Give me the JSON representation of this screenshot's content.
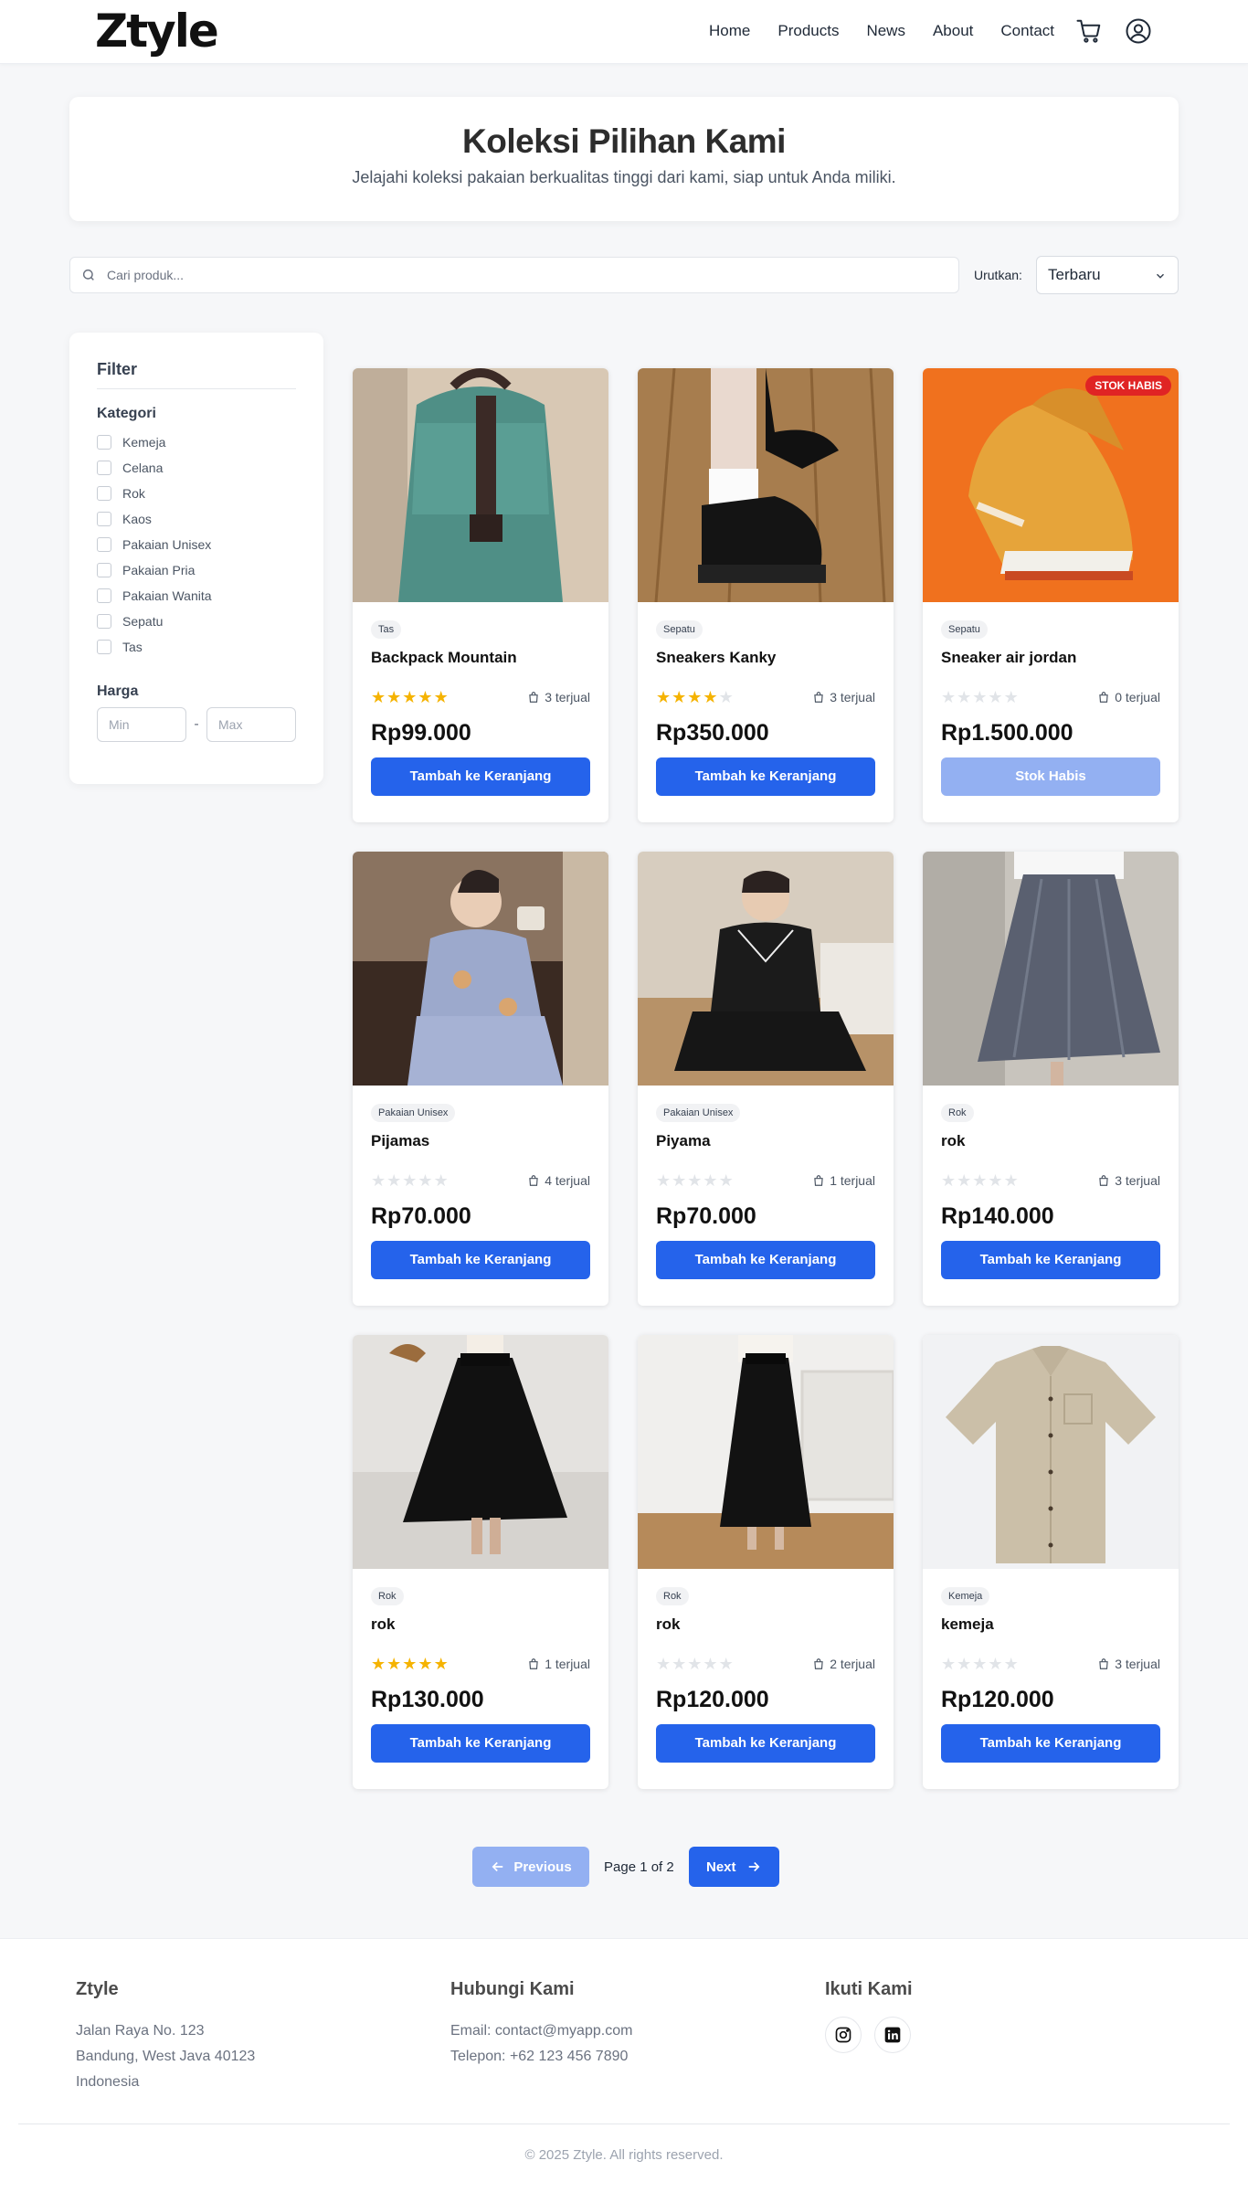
{
  "brand": {
    "logo": "Ztyle"
  },
  "nav": {
    "items": [
      "Home",
      "Products",
      "News",
      "About",
      "Contact"
    ],
    "cart_icon": "cart-icon",
    "user_icon": "user-icon"
  },
  "hero": {
    "title": "Koleksi Pilihan Kami",
    "subtitle": "Jelajahi koleksi pakaian berkualitas tinggi dari kami, siap untuk Anda miliki."
  },
  "search": {
    "placeholder": "Cari produk..."
  },
  "sort": {
    "label": "Urutkan:",
    "selected": "Terbaru"
  },
  "filter": {
    "title": "Filter",
    "category_title": "Kategori",
    "categories": [
      "Kemeja",
      "Celana",
      "Rok",
      "Kaos",
      "Pakaian Unisex",
      "Pakaian Pria",
      "Pakaian Wanita",
      "Sepatu",
      "Tas"
    ],
    "price_title": "Harga",
    "min_placeholder": "Min",
    "max_placeholder": "Max",
    "separator": "-"
  },
  "products": [
    {
      "category": "Tas",
      "name": "Backpack Mountain",
      "rating": 5,
      "sold": "3 terjual",
      "price": "Rp99.000",
      "button": "Tambah ke Keranjang",
      "sold_out": false
    },
    {
      "category": "Sepatu",
      "name": "Sneakers Kanky",
      "rating": 4,
      "sold": "3 terjual",
      "price": "Rp350.000",
      "button": "Tambah ke Keranjang",
      "sold_out": false
    },
    {
      "category": "Sepatu",
      "name": "Sneaker air jordan",
      "rating": 0,
      "sold": "0 terjual",
      "price": "Rp1.500.000",
      "button": "Stok Habis",
      "sold_out": true,
      "tag": "STOK HABIS"
    },
    {
      "category": "Pakaian Unisex",
      "name": "Pijamas",
      "rating": 0,
      "sold": "4 terjual",
      "price": "Rp70.000",
      "button": "Tambah ke Keranjang",
      "sold_out": false
    },
    {
      "category": "Pakaian Unisex",
      "name": "Piyama",
      "rating": 0,
      "sold": "1 terjual",
      "price": "Rp70.000",
      "button": "Tambah ke Keranjang",
      "sold_out": false
    },
    {
      "category": "Rok",
      "name": "rok",
      "rating": 0,
      "sold": "3 terjual",
      "price": "Rp140.000",
      "button": "Tambah ke Keranjang",
      "sold_out": false
    },
    {
      "category": "Rok",
      "name": "rok",
      "rating": 5,
      "sold": "1 terjual",
      "price": "Rp130.000",
      "button": "Tambah ke Keranjang",
      "sold_out": false
    },
    {
      "category": "Rok",
      "name": "rok",
      "rating": 0,
      "sold": "2 terjual",
      "price": "Rp120.000",
      "button": "Tambah ke Keranjang",
      "sold_out": false
    },
    {
      "category": "Kemeja",
      "name": "kemeja",
      "rating": 0,
      "sold": "3 terjual",
      "price": "Rp120.000",
      "button": "Tambah ke Keranjang",
      "sold_out": false
    }
  ],
  "pagination": {
    "prev": "Previous",
    "info": "Page 1 of 2",
    "next": "Next"
  },
  "footer": {
    "brand": "Ztyle",
    "address": [
      "Jalan Raya No. 123",
      "Bandung, West Java 40123",
      "Indonesia"
    ],
    "contact_title": "Hubungi Kami",
    "email": "Email: contact@myapp.com",
    "phone": "Telepon: +62 123 456 7890",
    "follow_title": "Ikuti Kami",
    "social_icons": [
      "instagram-icon",
      "linkedin-icon"
    ],
    "copyright": "© 2025 Ztyle. All rights reserved."
  },
  "colors": {
    "primary": "#2563eb",
    "primary_disabled": "#93b0f2",
    "star": "#f5b301",
    "soldout": "#e02424"
  }
}
